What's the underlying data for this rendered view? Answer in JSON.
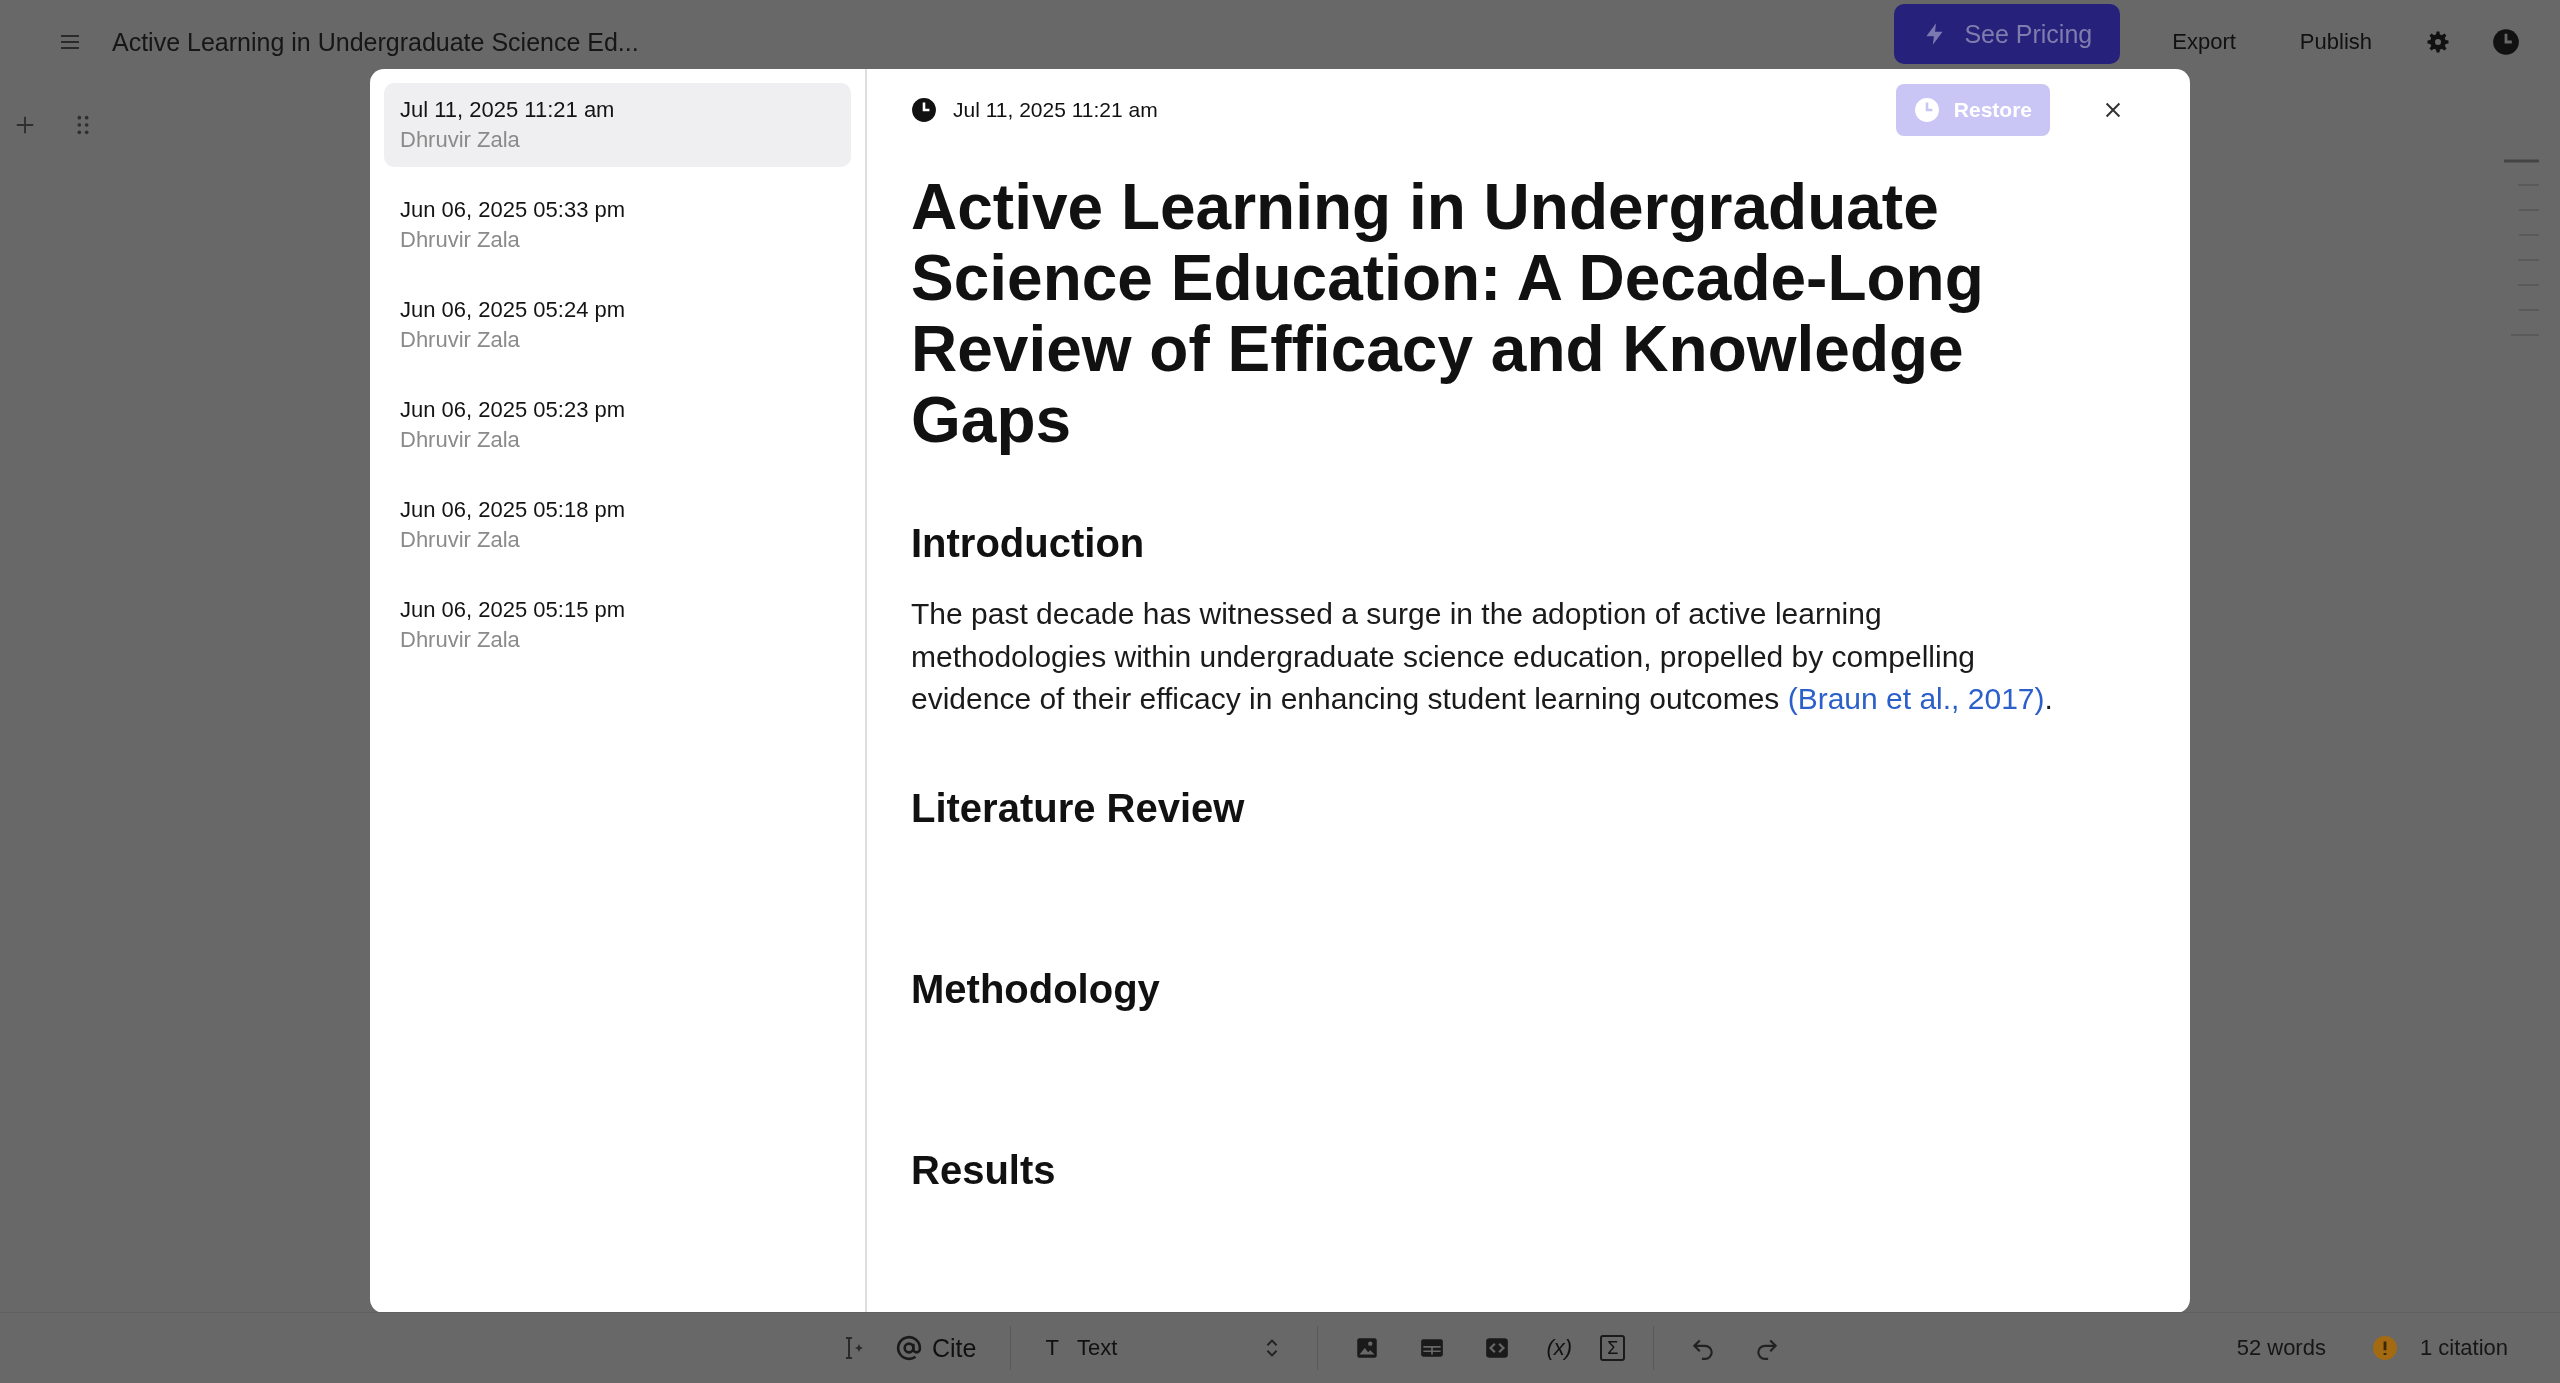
{
  "top_bar": {
    "document_title": "Active Learning in Undergraduate Science Ed...",
    "pricing_button": "See Pricing",
    "export_button": "Export",
    "publish_button": "Publish"
  },
  "history": {
    "versions": [
      {
        "timestamp": "Jul 11, 2025 11:21 am",
        "author": "Dhruvir Zala",
        "selected": true
      },
      {
        "timestamp": "Jun 06, 2025 05:33 pm",
        "author": "Dhruvir Zala",
        "selected": false
      },
      {
        "timestamp": "Jun 06, 2025 05:24 pm",
        "author": "Dhruvir Zala",
        "selected": false
      },
      {
        "timestamp": "Jun 06, 2025 05:23 pm",
        "author": "Dhruvir Zala",
        "selected": false
      },
      {
        "timestamp": "Jun 06, 2025 05:18 pm",
        "author": "Dhruvir Zala",
        "selected": false
      },
      {
        "timestamp": "Jun 06, 2025 05:15 pm",
        "author": "Dhruvir Zala",
        "selected": false
      }
    ]
  },
  "preview": {
    "timestamp": "Jul 11, 2025 11:21 am",
    "restore_button": {
      "label": "Restore",
      "disabled": true
    },
    "title": "Active Learning in Undergraduate Science Education: A Decade-Long Review of Efficacy and Knowledge Gaps",
    "sections": [
      {
        "heading": "Introduction",
        "paragraph": "The past decade has witnessed a surge in the adoption of active learning methodologies within undergraduate science education, propelled by compelling evidence of their efficacy in enhancing student learning outcomes ",
        "citation": "(Braun et al., 2017)",
        "after_citation": "."
      },
      {
        "heading": "Literature Review"
      },
      {
        "heading": "Methodology"
      },
      {
        "heading": "Results"
      }
    ]
  },
  "toolbar": {
    "cite_button": "Cite",
    "block_type_icon": "T",
    "block_type": "Text",
    "variable_button": "(x)",
    "formula_button": "Σ"
  },
  "status_bar": {
    "word_count": "52 words",
    "citations": "1 citation"
  }
}
